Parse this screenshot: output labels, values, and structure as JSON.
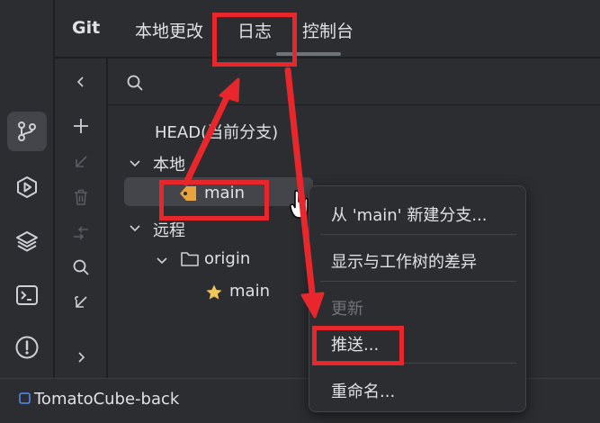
{
  "tool_window": {
    "title": "Git",
    "tabs": [
      {
        "label": "本地更改"
      },
      {
        "label": "日志"
      },
      {
        "label": "控制台"
      }
    ]
  },
  "branch_tree": {
    "head_label": "HEAD(当前分支)",
    "local_group": "本地",
    "local_branch": "main",
    "remote_group": "远程",
    "remote_name": "origin",
    "remote_branch": "main"
  },
  "context_menu": {
    "items": [
      {
        "label": "从 'main' 新建分支..."
      },
      {
        "label": "显示与工作树的差异"
      },
      {
        "label": "更新",
        "disabled": true
      },
      {
        "label": "推送..."
      },
      {
        "label": "重命名..."
      }
    ]
  },
  "status_bar": {
    "project": "TomatoCube-back"
  },
  "colors": {
    "annotation_red": "#e8272c",
    "tag_yellow": "#e8a33d",
    "star_yellow": "#f2c55c"
  },
  "icons": {
    "activity_bar": [
      "git-branch-icon",
      "run-icon",
      "layers-icon",
      "terminal-icon",
      "problems-icon"
    ],
    "side_toolbar": [
      "chevron-left-icon",
      "plus-icon",
      "arrow-down-left-icon",
      "trash-icon",
      "merge-arrow-icon",
      "search-icon",
      "compare-icon",
      "chevron-right-icon"
    ]
  }
}
